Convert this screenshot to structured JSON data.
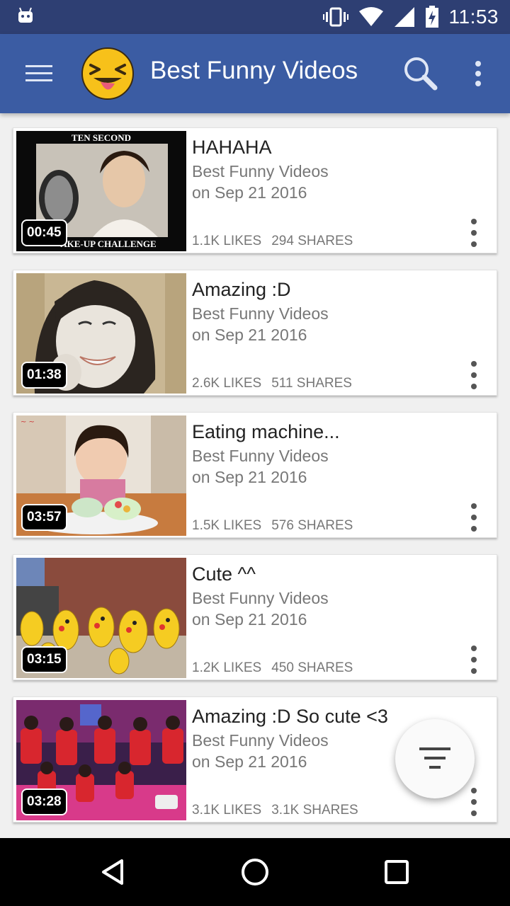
{
  "status_bar": {
    "time": "11:53",
    "icons": [
      "android-icon",
      "vibrate-icon",
      "wifi-icon",
      "signal-icon",
      "battery-charging-icon"
    ]
  },
  "app_bar": {
    "title": "Best Funny Videos",
    "logo_icon": "laughing-emoji-icon",
    "menu_icon": "hamburger-menu-icon",
    "search_icon": "search-icon",
    "overflow_icon": "more-vert-icon"
  },
  "videos": [
    {
      "title": "HAHAHA",
      "channel": "Best Funny Videos",
      "date": "on Sep 21 2016",
      "likes": "1.1K LIKES",
      "shares": "294 SHARES",
      "duration": "00:45",
      "thumb_text_top": "TEN SECOND",
      "thumb_text_bottom": "AKE-UP CHALLENGE"
    },
    {
      "title": "Amazing :D",
      "channel": "Best Funny Videos",
      "date": "on Sep 21 2016",
      "likes": "2.6K LIKES",
      "shares": "511 SHARES",
      "duration": "01:38"
    },
    {
      "title": "Eating machine...",
      "channel": "Best Funny Videos",
      "date": "on Sep 21 2016",
      "likes": "1.5K LIKES",
      "shares": "576 SHARES",
      "duration": "03:57"
    },
    {
      "title": "Cute ^^",
      "channel": "Best Funny Videos",
      "date": "on Sep 21 2016",
      "likes": "1.2K LIKES",
      "shares": "450 SHARES",
      "duration": "03:15"
    },
    {
      "title": "Amazing :D So cute <3",
      "channel": "Best Funny Videos",
      "date": "on Sep 21 2016",
      "likes": "3.1K LIKES",
      "shares": "3.1K SHARES",
      "duration": "03:28"
    }
  ],
  "fab": {
    "icon": "filter-sort-icon"
  },
  "nav_bar": {
    "back_icon": "back-triangle-icon",
    "home_icon": "home-circle-icon",
    "recents_icon": "recents-square-icon"
  },
  "colors": {
    "status_bar": "#2e3f73",
    "app_bar": "#3b5ca3",
    "card_bg": "#ffffff",
    "list_bg": "#f0f0f0"
  }
}
